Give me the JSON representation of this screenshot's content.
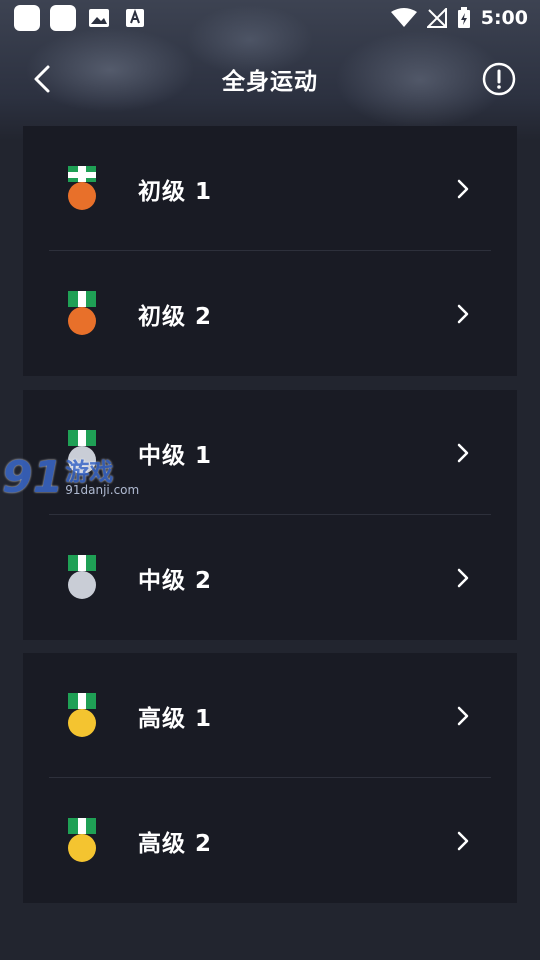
{
  "status_bar": {
    "time": "5:00",
    "icons": [
      "notification-icon",
      "notification-icon",
      "image-icon",
      "text-a-icon",
      "wifi-icon",
      "no-signal-icon",
      "battery-charging-icon"
    ]
  },
  "header": {
    "title": "全身运动",
    "back_icon": "chevron-left-icon",
    "info_icon": "alert-circle-icon"
  },
  "groups": [
    {
      "medal": "bronze",
      "medal_color": "#e8702a",
      "items": [
        {
          "label": "初级 1"
        },
        {
          "label": "初级 2"
        }
      ]
    },
    {
      "medal": "silver",
      "medal_color": "#c9cdd6",
      "items": [
        {
          "label": "中级 1"
        },
        {
          "label": "中级 2"
        }
      ]
    },
    {
      "medal": "gold",
      "medal_color": "#f4c430",
      "items": [
        {
          "label": "高级 1"
        },
        {
          "label": "高级 2"
        }
      ]
    }
  ],
  "ribbon_colors": {
    "green": "#1fa055",
    "white": "#ffffff"
  },
  "watermark": {
    "logo": "91",
    "name": "游戏",
    "url": "91danji.com"
  }
}
